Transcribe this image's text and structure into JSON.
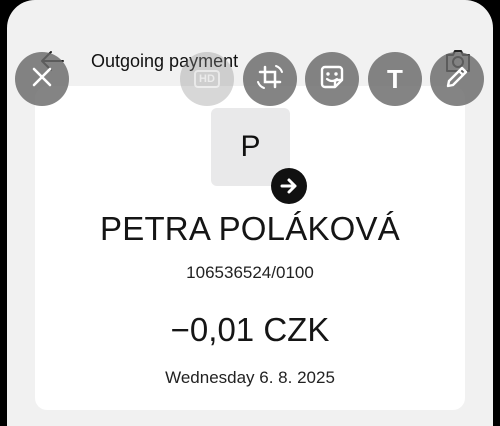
{
  "header": {
    "title": "Outgoing payment",
    "back_icon": "arrow-left-icon",
    "camera_icon": "camera-icon"
  },
  "editor_tools": {
    "close_icon": "close-icon",
    "hd_label": "HD",
    "crop_icon": "crop-rotate-icon",
    "sticker_icon": "sticker-icon",
    "text_label": "T",
    "draw_icon": "pencil-icon"
  },
  "payment": {
    "avatar_initial": "P",
    "direction_icon": "arrow-right-icon",
    "recipient_name": "PETRA POLÁKOVÁ",
    "account_number": "106536524/0100",
    "amount": "−0,01 CZK",
    "date": "Wednesday 6. 8. 2025"
  },
  "colors": {
    "background": "#f1f1f1",
    "card": "#ffffff",
    "tool_button": "#696969",
    "text": "#151515"
  }
}
